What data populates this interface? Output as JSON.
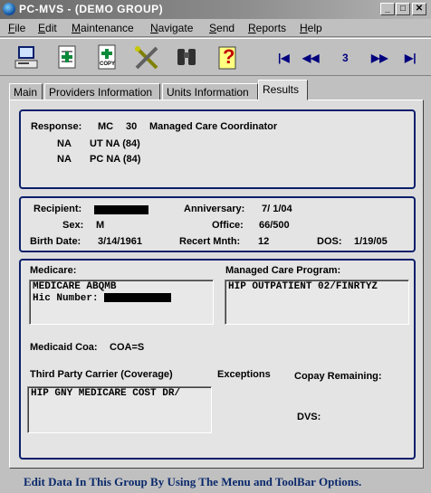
{
  "window": {
    "title": "PC-MVS  -  (DEMO GROUP)"
  },
  "menu": {
    "items": [
      {
        "accel": "F",
        "rest": "ile"
      },
      {
        "accel": "E",
        "rest": "dit"
      },
      {
        "accel": "M",
        "rest": "aintenance"
      },
      {
        "accel": "N",
        "rest": "avigate"
      },
      {
        "accel": "S",
        "rest": "end"
      },
      {
        "accel": "R",
        "rest": "eports"
      },
      {
        "accel": "H",
        "rest": "elp"
      }
    ]
  },
  "toolbar": {
    "copy_label": "COPY",
    "help_glyph": "?",
    "first_glyph": "|◀",
    "prev_glyph": "◀◀",
    "page_number": "3",
    "next_glyph": "▶▶",
    "last_glyph": "▶|"
  },
  "tabs": [
    {
      "label": "Main"
    },
    {
      "label": "Providers Information"
    },
    {
      "label": "Units Information"
    },
    {
      "label": "Results"
    }
  ],
  "response": {
    "label": "Response:",
    "code": "MC",
    "num": "30",
    "desc": "Managed Care Coordinator",
    "lines": [
      {
        "a": "NA",
        "b": "UT NA (84)"
      },
      {
        "a": "NA",
        "b": "PC NA (84)"
      }
    ]
  },
  "recipient": {
    "recipient_label": "Recipient:",
    "anniversary_label": "Anniversary:",
    "anniversary": "7/ 1/04",
    "sex_label": "Sex:",
    "sex": "M",
    "office_label": "Office:",
    "office": "66/500",
    "birth_label": "Birth Date:",
    "birth": "3/14/1961",
    "recert_label": "Recert Mnth:",
    "recert": "12",
    "dos_label": "DOS:",
    "dos": "1/19/05"
  },
  "coverage": {
    "medicare_label": "Medicare:",
    "medicare_line1": "MEDICARE ABQMB",
    "hic_label": "Hic Number:",
    "mcp_label": "Managed Care Program:",
    "mcp_value": "HIP OUTPATIENT  02/FINRTYZ",
    "medicaid_label": "Medicaid Coa:",
    "medicaid_value": "COA=S",
    "tpc_label": "Third Party Carrier (Coverage)",
    "tpc_value": "HIP GNY MEDICARE COST  DR/",
    "exceptions_label": "Exceptions",
    "copay_label": "Copay Remaining:",
    "dvs_label": "DVS:"
  },
  "status": {
    "text": "Edit Data In This Group By Using The Menu and ToolBar Options."
  }
}
